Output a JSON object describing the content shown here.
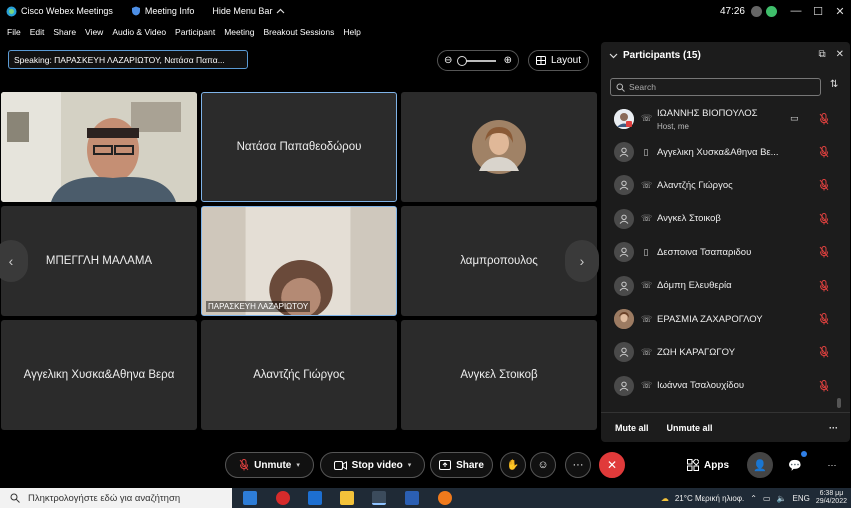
{
  "titlebar": {
    "app_name": "Cisco Webex Meetings",
    "meeting_info": "Meeting Info",
    "hide_menu": "Hide Menu Bar",
    "timer": "47:26"
  },
  "menu": [
    "File",
    "Edit",
    "Share",
    "View",
    "Audio & Video",
    "Participant",
    "Meeting",
    "Breakout Sessions",
    "Help"
  ],
  "speaking": "Speaking: ΠΑΡΑΣΚΕΥΗ ΛΑΖΑΡΙΩΤΟΥ, Νατάσα Παπα...",
  "layout_label": "Layout",
  "tiles": [
    {
      "name": "",
      "kind": "video"
    },
    {
      "name": "Νατάσα Παπαθεοδώρου",
      "kind": "name"
    },
    {
      "name": "",
      "kind": "avatar"
    },
    {
      "name": "ΜΠΕΓΓΛΗ ΜΑΛΑΜΑ",
      "kind": "name"
    },
    {
      "name": "ΠΑΡΑΣΚΕΥΗ ΛΑΖΑΡΙΩΤΟΥ",
      "kind": "video"
    },
    {
      "name": "λαμπροπουλος",
      "kind": "name"
    },
    {
      "name": "Αγγελικη Χυσκα&Αθηνα Βερα",
      "kind": "name"
    },
    {
      "name": "Αλαντζής Γιώργος",
      "kind": "name"
    },
    {
      "name": "Ανγκελ Στοικοβ",
      "kind": "name"
    }
  ],
  "participants": {
    "title": "Participants (15)",
    "search_placeholder": "Search",
    "list": [
      {
        "name": "ΙΩΑΝΝΗΣ ΒΙΟΠΟΥΛΟΣ",
        "sub": "Host, me",
        "avatar": "photo",
        "status": "phone-icon"
      },
      {
        "name": "Αγγελικη Χυσκα&Αθηνα Βε...",
        "sub": "",
        "avatar": "default",
        "status": "mobile-icon"
      },
      {
        "name": "Αλαντζής Γιώργος",
        "sub": "",
        "avatar": "default",
        "status": "phone-icon"
      },
      {
        "name": "Ανγκελ Στοικοβ",
        "sub": "",
        "avatar": "default",
        "status": "phone-icon"
      },
      {
        "name": "Δεσποινα Τσαπαριδου",
        "sub": "",
        "avatar": "default",
        "status": "mobile-icon"
      },
      {
        "name": "Δόμπη Ελευθερία",
        "sub": "",
        "avatar": "default",
        "status": "phone-icon"
      },
      {
        "name": "ΕΡΑΣΜΙΑ ΖΑΧΑΡΟΓΛΟΥ",
        "sub": "",
        "avatar": "photo",
        "status": "phone-icon"
      },
      {
        "name": "ΖΩΗ ΚΑΡΑΓΩΓΟΥ",
        "sub": "",
        "avatar": "default",
        "status": "phone-icon"
      },
      {
        "name": "Ιωάννα Τσαλουχίδου",
        "sub": "",
        "avatar": "default",
        "status": "phone-icon"
      }
    ],
    "mute_all": "Mute all",
    "unmute_all": "Unmute all"
  },
  "controls": {
    "unmute": "Unmute",
    "stop_video": "Stop video",
    "share": "Share",
    "apps": "Apps"
  },
  "taskbar": {
    "search_placeholder": "Πληκτρολογήστε εδώ για αναζήτηση",
    "weather": "21°C  Μερική ηλιοφ.",
    "lang": "ENG",
    "time": "6:38 μμ",
    "date": "29/4/2022"
  },
  "colors": {
    "mute_red": "#e0413f",
    "leave_red": "#e03a3a",
    "accent_blue": "#7fb3e8",
    "online_green": "#2fa84f"
  }
}
